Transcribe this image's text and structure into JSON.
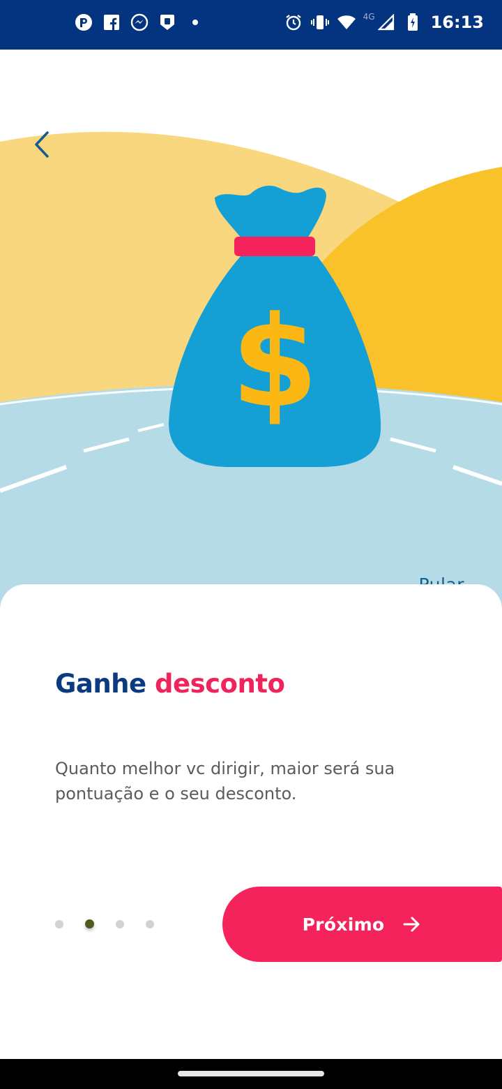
{
  "status_bar": {
    "time": "16:13",
    "network_label": "4G",
    "left_icons": [
      "pokemon-go-icon",
      "facebook-icon",
      "messenger-icon",
      "shield-app-icon",
      "dot-icon"
    ],
    "right_icons": [
      "alarm-icon",
      "vibrate-icon",
      "wifi-icon",
      "signal-icon",
      "battery-charging-icon"
    ]
  },
  "header": {
    "back_icon": "chevron-left-icon"
  },
  "onboarding": {
    "skip_label": "Pular",
    "title_part1": "Ganhe",
    "title_part2": "desconto",
    "description": "Quanto melhor vc dirigir, maior será sua pontuação e o seu desconto.",
    "pagination": {
      "total": 4,
      "current": 2
    },
    "next_label": "Próximo",
    "next_icon": "arrow-right-icon"
  },
  "colors": {
    "status_bar_bg": "#04347f",
    "title_primary": "#0b3a7f",
    "title_accent": "#f0245c",
    "button_bg": "#f5235b",
    "bag_blue": "#14a0d4",
    "dollar_yellow": "#fbb814",
    "hill_light": "#f9d77f",
    "hill_dark": "#f9c22a",
    "road": "#b5dbe6"
  }
}
